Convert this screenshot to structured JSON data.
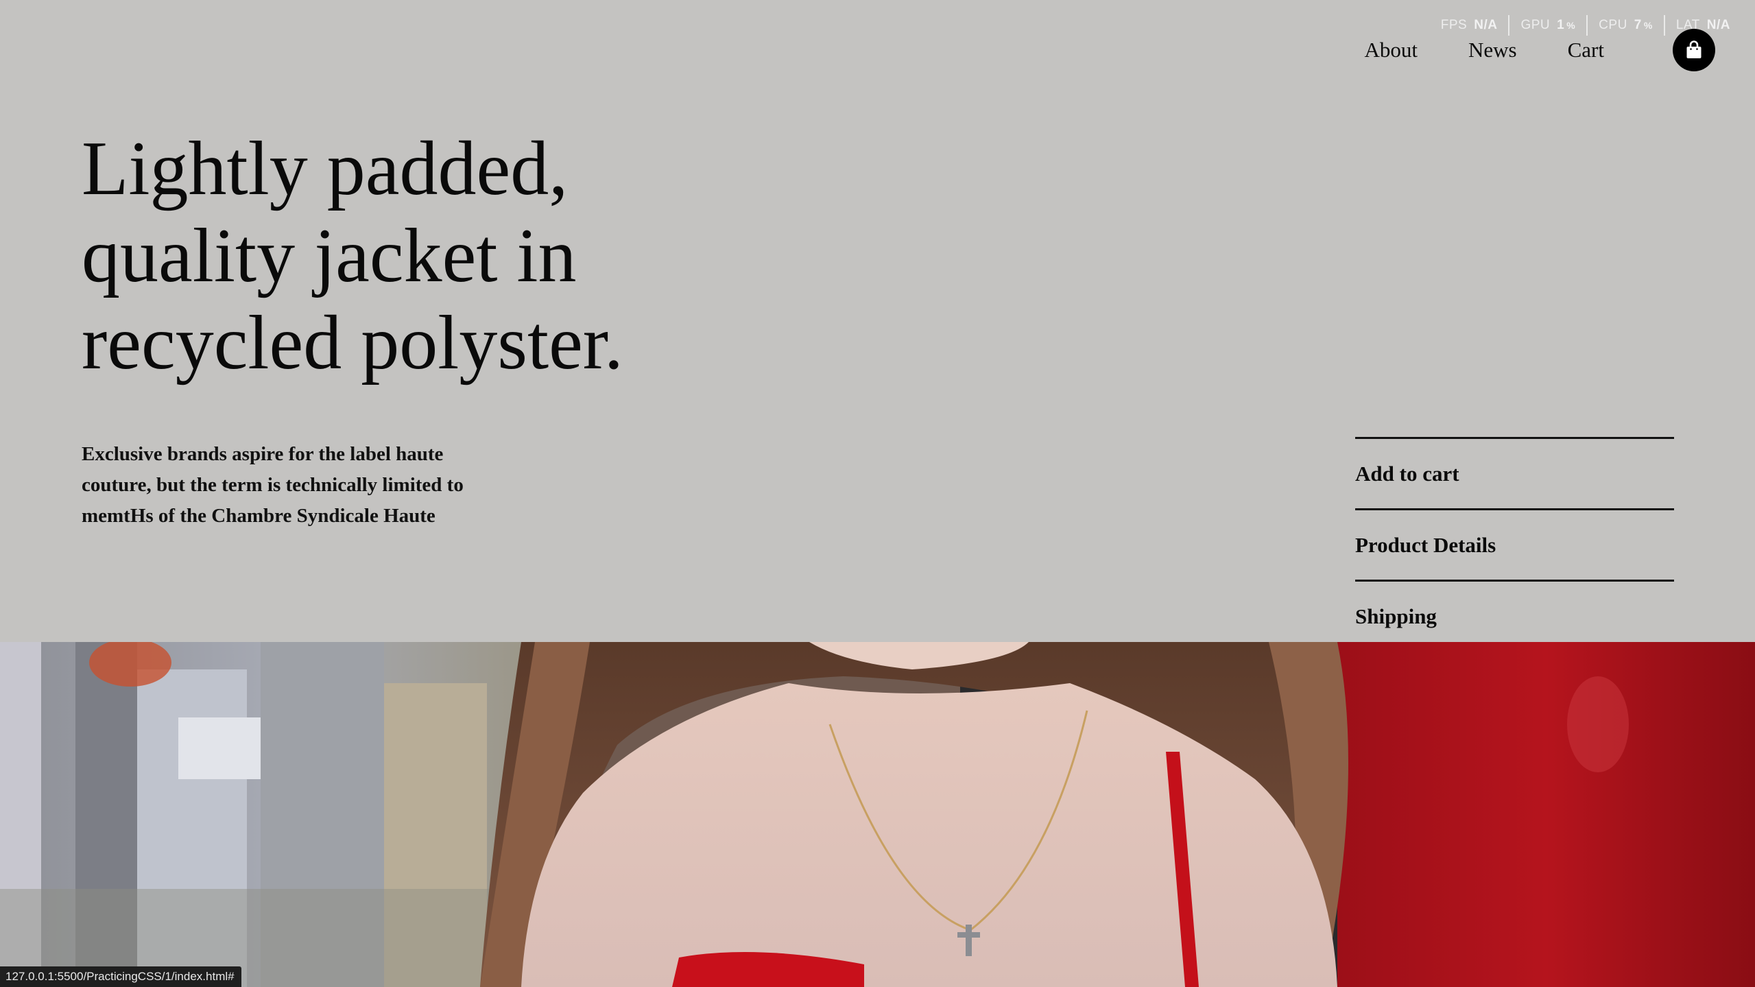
{
  "perf_overlay": {
    "stats": [
      {
        "label": "FPS",
        "value": "N/A",
        "unit": ""
      },
      {
        "label": "GPU",
        "value": "1",
        "unit": "%"
      },
      {
        "label": "CPU",
        "value": "7",
        "unit": "%"
      },
      {
        "label": "LAT",
        "value": "N/A",
        "unit": ""
      }
    ]
  },
  "nav": {
    "links": [
      "About",
      "News",
      "Cart"
    ],
    "cart_icon": "shopping-bag-icon"
  },
  "hero": {
    "headline_lines": [
      "Lightly padded,",
      "quality jacket in",
      "recycled polyster."
    ],
    "description": "Exclusive brands aspire for the label haute couture, but the term is technically limited to memtHs of the Chambre Syndicale Haute"
  },
  "accordion": {
    "items": [
      "Add to cart",
      "Product Details",
      "Shipping"
    ]
  },
  "status_bar": {
    "url": "127.0.0.1:5500/PracticingCSS/1/index.html#"
  },
  "colors": {
    "background": "#c4c3c1",
    "text": "#0b0b0b",
    "accent_red": "#b3121a"
  }
}
